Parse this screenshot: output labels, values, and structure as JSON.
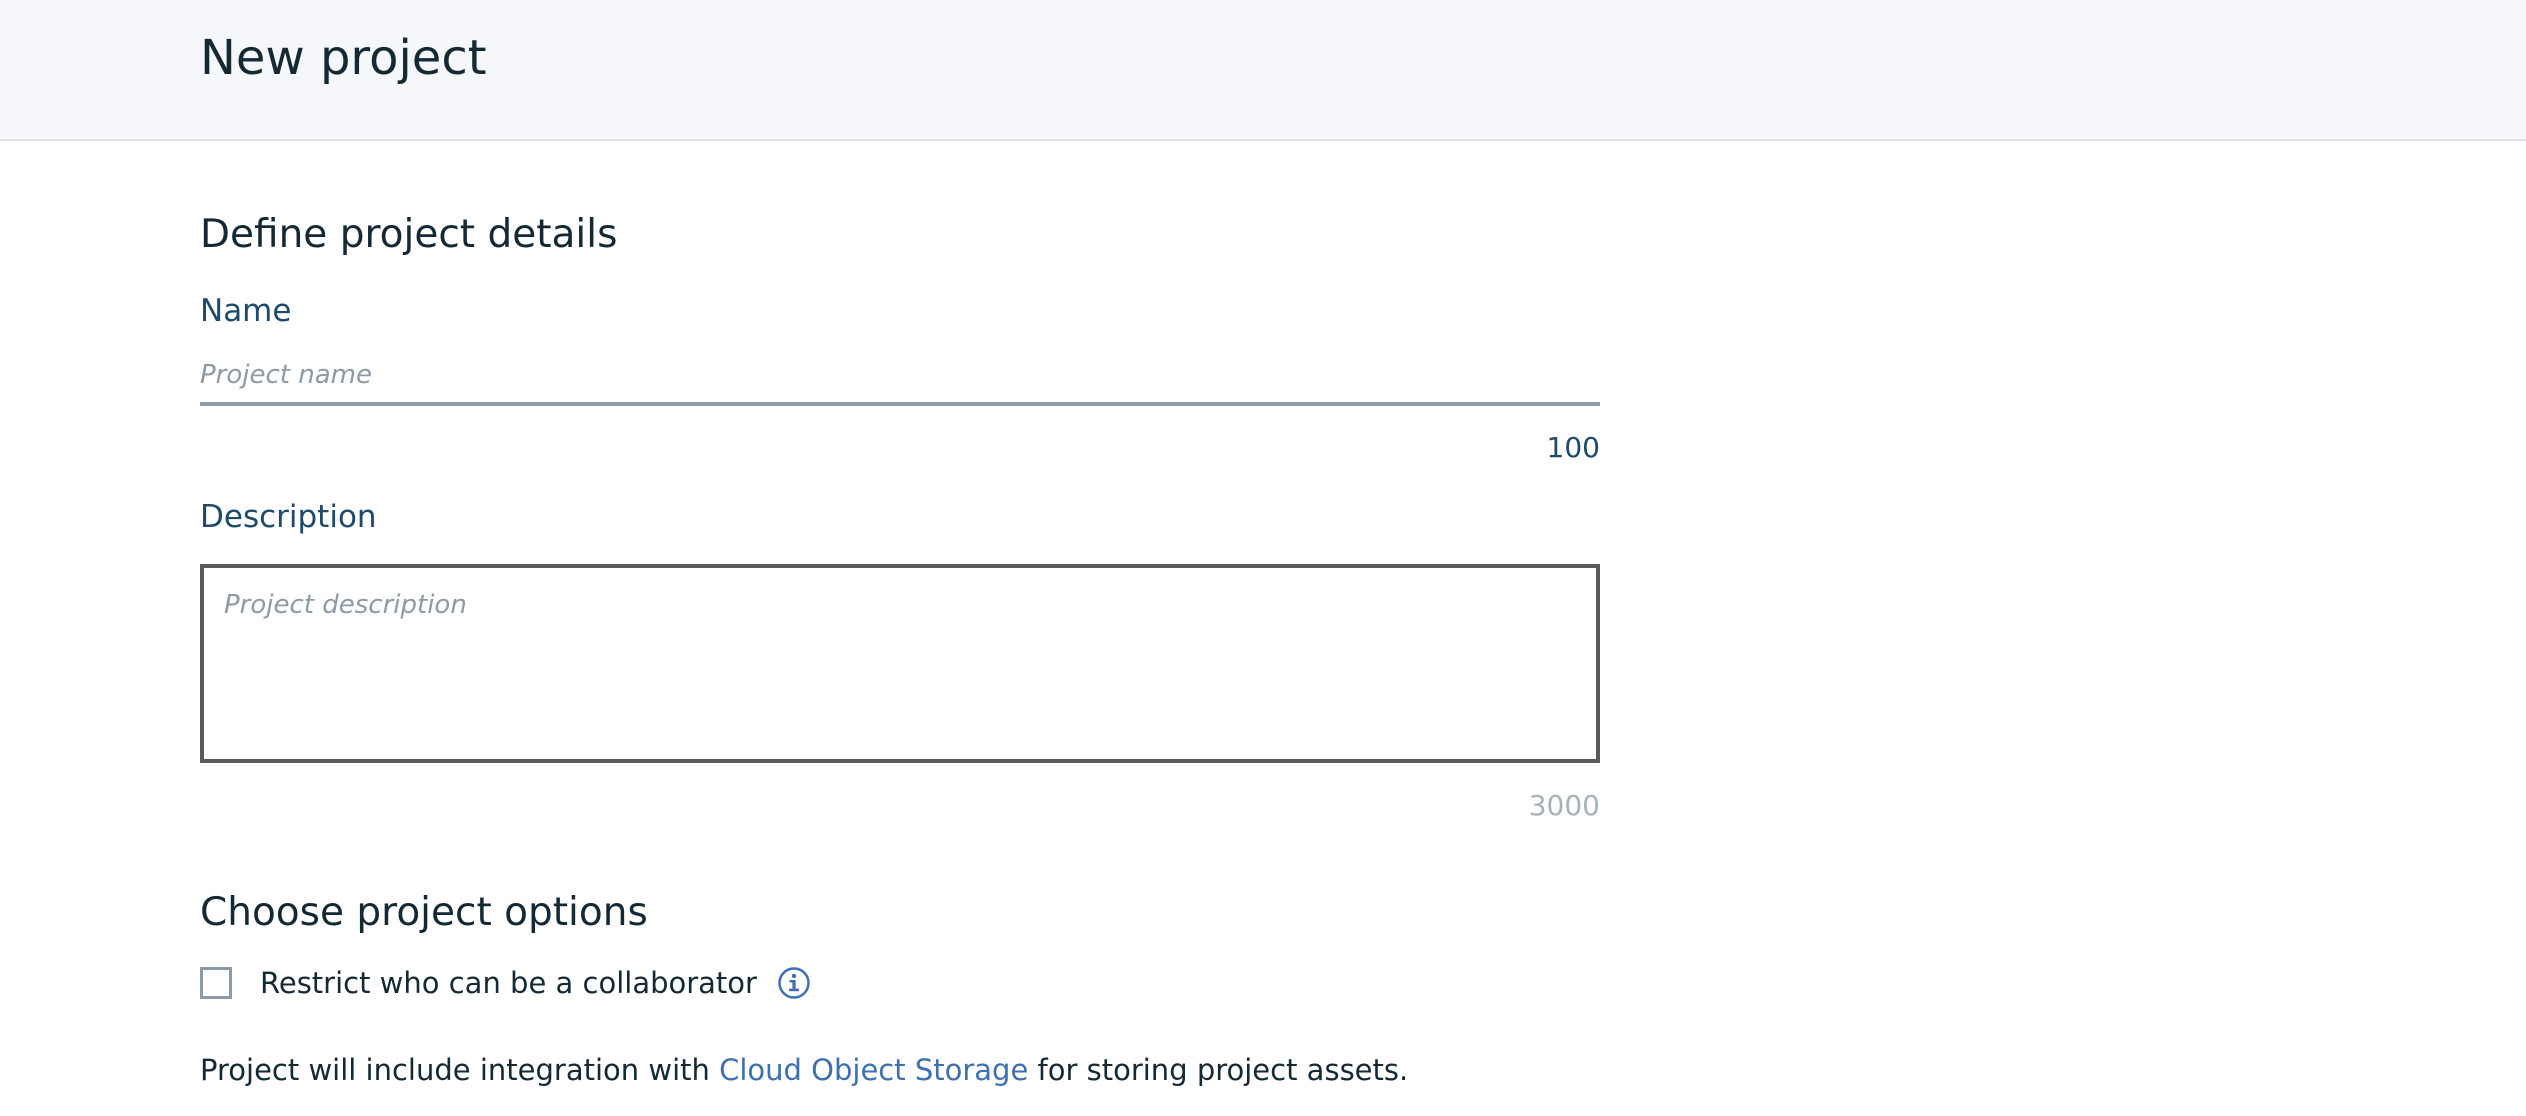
{
  "header": {
    "title": "New project"
  },
  "details": {
    "section_title": "Define project details",
    "name": {
      "label": "Name",
      "placeholder": "Project name",
      "value": "",
      "max_length": "100"
    },
    "description": {
      "label": "Description",
      "placeholder": "Project description",
      "value": "",
      "max_length": "3000"
    }
  },
  "options": {
    "section_title": "Choose project options",
    "restrict_collaborator": {
      "label": "Restrict who can be a collaborator",
      "checked": false,
      "icon": "info-icon"
    },
    "integration": {
      "prefix": "Project will include integration with ",
      "link_text": "Cloud Object Storage",
      "suffix": " for storing project assets."
    }
  },
  "colors": {
    "header_bg": "#f5f7fa",
    "link": "#3d70b2",
    "label": "#1e4b6b",
    "text": "#152935"
  }
}
